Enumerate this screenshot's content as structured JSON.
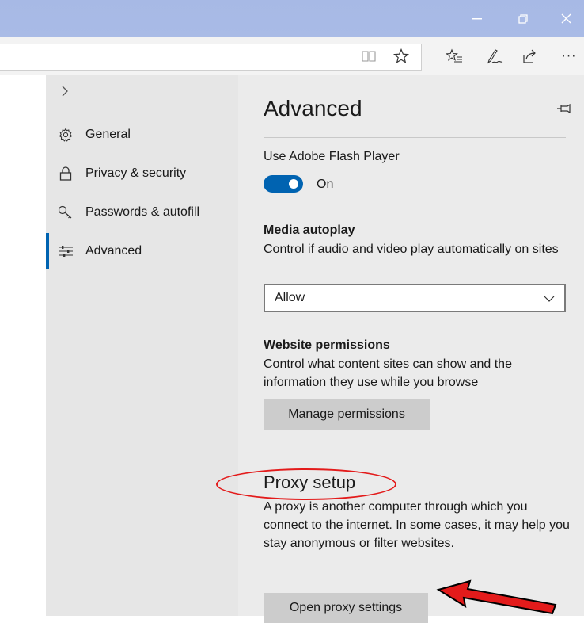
{
  "titlebar": {
    "minimize_icon": "minimize-icon",
    "restore_icon": "restore-icon",
    "close_icon": "close-icon"
  },
  "toolbar": {
    "icons": [
      "reading-view-icon",
      "favorite-star-icon",
      "favorites-hub-icon",
      "pen-icon",
      "share-icon",
      "more-icon"
    ],
    "more_label": "···"
  },
  "sidebar": {
    "items": [
      {
        "label": "General",
        "icon": "gear-icon"
      },
      {
        "label": "Privacy & security",
        "icon": "lock-icon"
      },
      {
        "label": "Passwords & autofill",
        "icon": "key-icon"
      },
      {
        "label": "Advanced",
        "icon": "sliders-icon",
        "active": true
      }
    ]
  },
  "content": {
    "title": "Advanced",
    "flash": {
      "label": "Use Adobe Flash Player",
      "toggle_state": "On"
    },
    "media_autoplay": {
      "heading": "Media autoplay",
      "description": "Control if audio and video play automatically on sites",
      "selected": "Allow"
    },
    "website_permissions": {
      "heading": "Website permissions",
      "description": "Control what content sites can show and the information they use while you browse",
      "button": "Manage permissions"
    },
    "proxy": {
      "heading": "Proxy setup",
      "description": "A proxy is another computer through which you connect to the internet. In some cases, it may help you stay anonymous or filter websites.",
      "button": "Open proxy settings"
    }
  },
  "colors": {
    "accent": "#0063b1",
    "annotation": "#e31b1b",
    "titlebar": "#a9bbe6"
  }
}
